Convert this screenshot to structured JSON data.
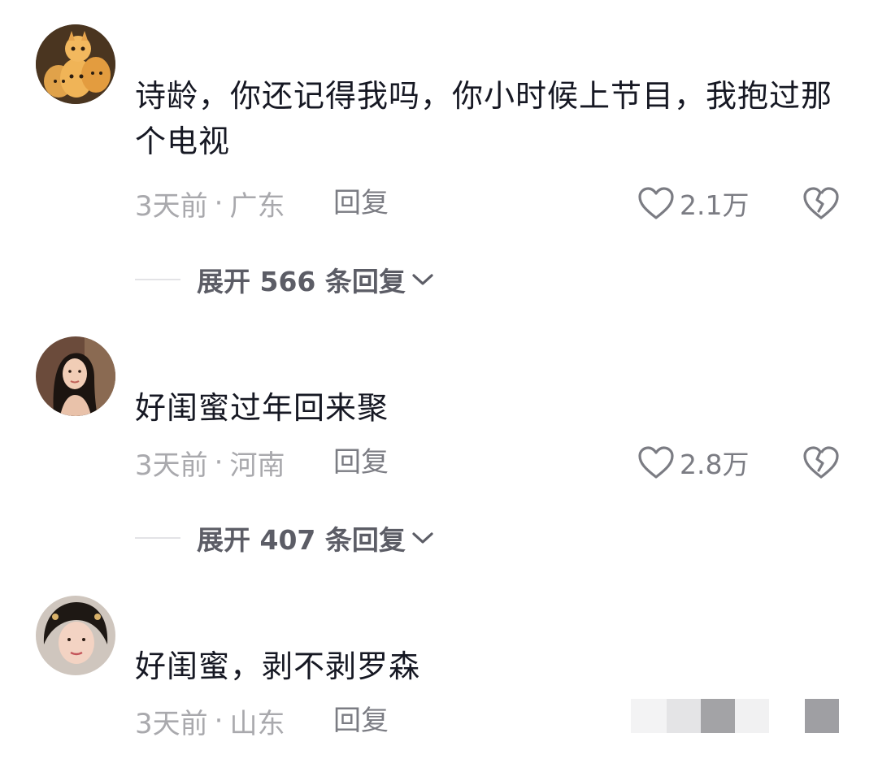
{
  "comments": [
    {
      "avatar": "cats-avatar",
      "text": "诗龄，你还记得我吗，你小时候上节目，我抱过那个电视",
      "time": "3天前",
      "dot": "·",
      "location": "广东",
      "reply_label": "回复",
      "likes": "2.1万",
      "expand_label": "展开 566 条回复"
    },
    {
      "avatar": "woman-avatar",
      "text": "好闺蜜过年回来聚",
      "time": "3天前",
      "dot": "·",
      "location": "河南",
      "reply_label": "回复",
      "likes": "2.8万",
      "expand_label": "展开 407 条回复"
    },
    {
      "avatar": "actress-avatar",
      "text": "好闺蜜，剥不剥罗森",
      "time": "3天前",
      "dot": "·",
      "location": "山东",
      "reply_label": "回复"
    }
  ],
  "colors": {
    "text": "#161823",
    "meta": "#a9a9ad",
    "action": "#7b7c83",
    "expand": "#5c5d66"
  },
  "icons": {
    "like": "heart-outline-icon",
    "dislike": "broken-heart-icon",
    "expand": "chevron-down-icon"
  }
}
